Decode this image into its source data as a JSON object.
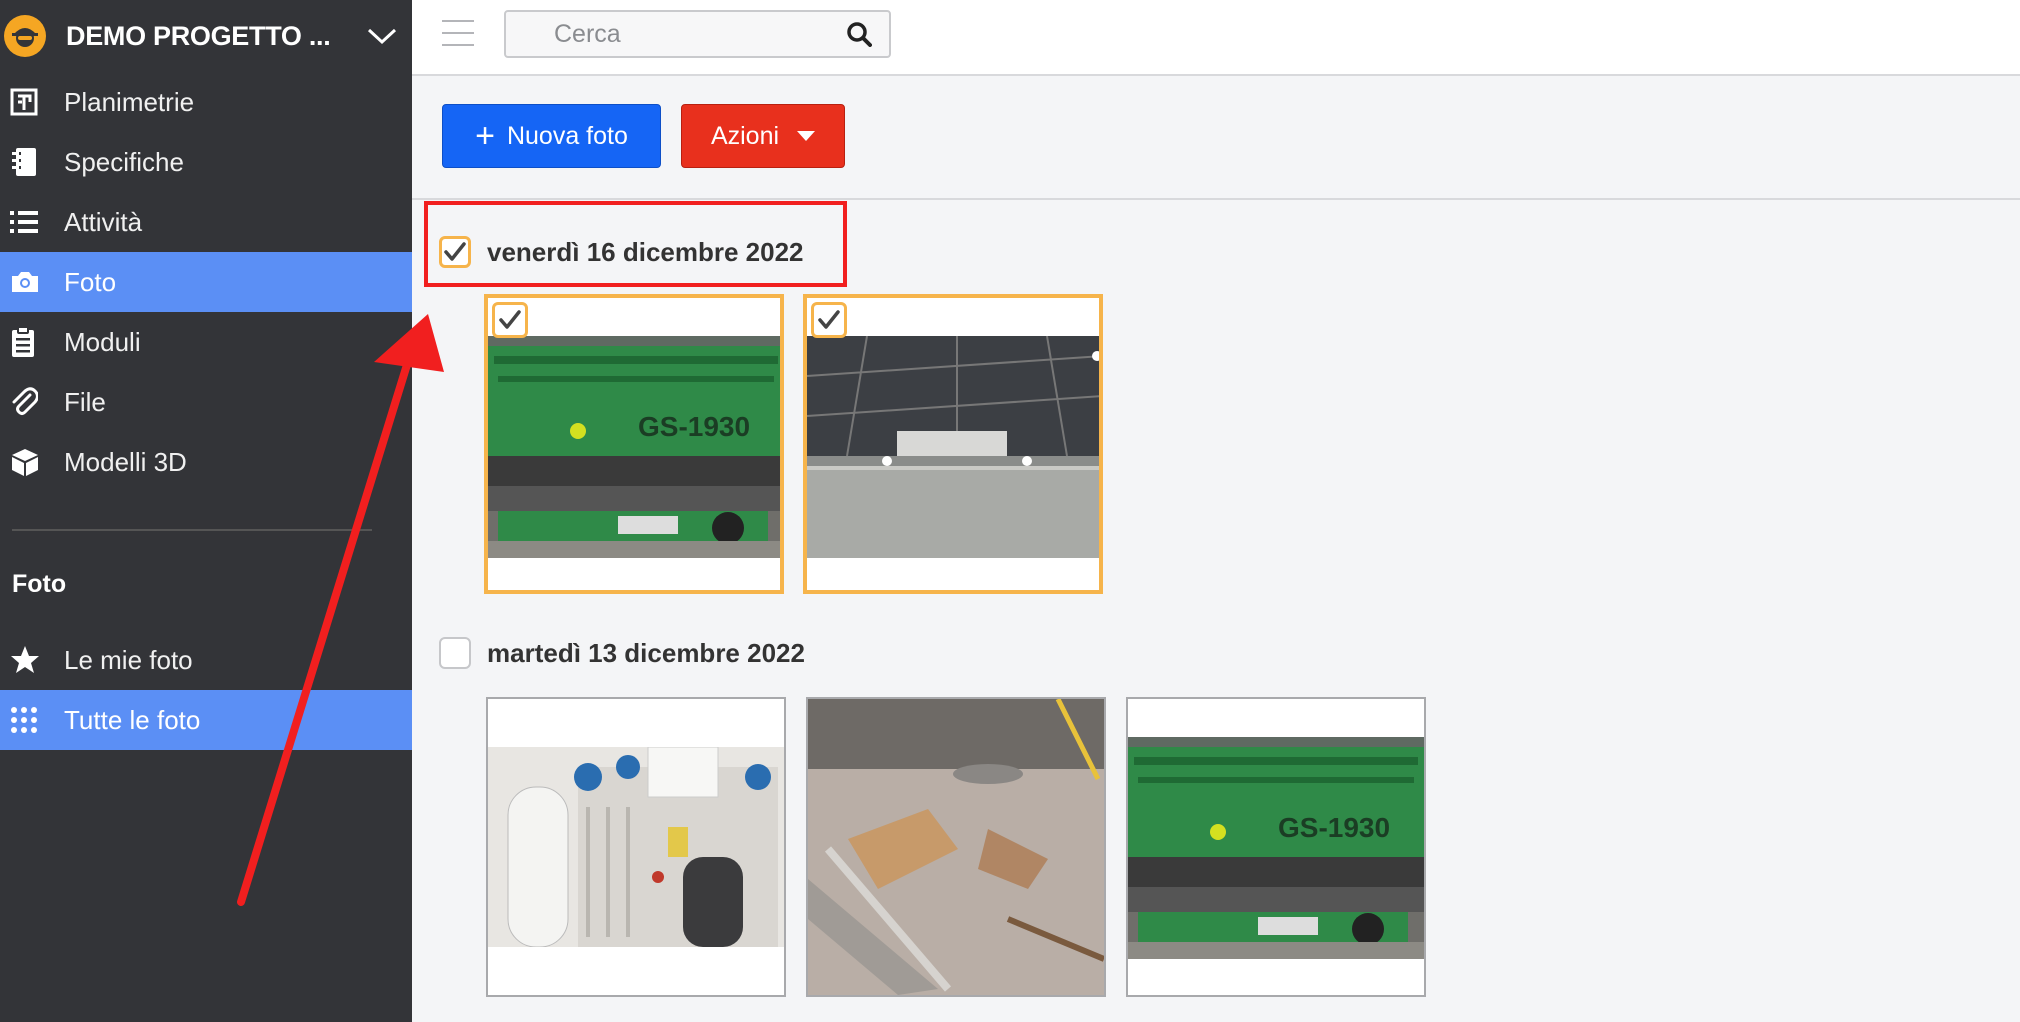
{
  "project": {
    "name": "DEMO PROGETTO ...",
    "icon": "worker-helmet-icon"
  },
  "nav": [
    {
      "label": "Planimetrie",
      "icon": "floorplan-icon",
      "active": false
    },
    {
      "label": "Specifiche",
      "icon": "notebook-icon",
      "active": false
    },
    {
      "label": "Attività",
      "icon": "list-icon",
      "active": false
    },
    {
      "label": "Foto",
      "icon": "camera-icon",
      "active": true
    },
    {
      "label": "Moduli",
      "icon": "clipboard-icon",
      "active": false
    },
    {
      "label": "File",
      "icon": "paperclip-icon",
      "active": false
    },
    {
      "label": "Modelli 3D",
      "icon": "cube-icon",
      "active": false
    }
  ],
  "photos_section": {
    "label": "Foto",
    "items": [
      {
        "label": "Le mie foto",
        "icon": "star-icon",
        "active": false
      },
      {
        "label": "Tutte le foto",
        "icon": "grid-dots-icon",
        "active": true
      }
    ]
  },
  "search": {
    "placeholder": "Cerca"
  },
  "toolbar": {
    "new_photo_label": "Nuova foto",
    "actions_label": "Azioni"
  },
  "groups": [
    {
      "date": "venerdì 16 dicembre 2022",
      "checked": true,
      "photos": [
        {
          "subject": "scissor-lift",
          "selected": true
        },
        {
          "subject": "ceiling",
          "selected": true
        }
      ]
    },
    {
      "date": "martedì 13 dicembre 2022",
      "checked": false,
      "photos": [
        {
          "subject": "boiler-room",
          "selected": false
        },
        {
          "subject": "floor-materials",
          "selected": false
        },
        {
          "subject": "scissor-lift",
          "selected": false
        }
      ]
    }
  ],
  "colors": {
    "sidebar_bg": "#333438",
    "active_item": "#5b8ff5",
    "primary_button": "#1565f5",
    "danger_button": "#e8301d",
    "selection": "#f6b44b",
    "annotation": "#f11f1f"
  }
}
